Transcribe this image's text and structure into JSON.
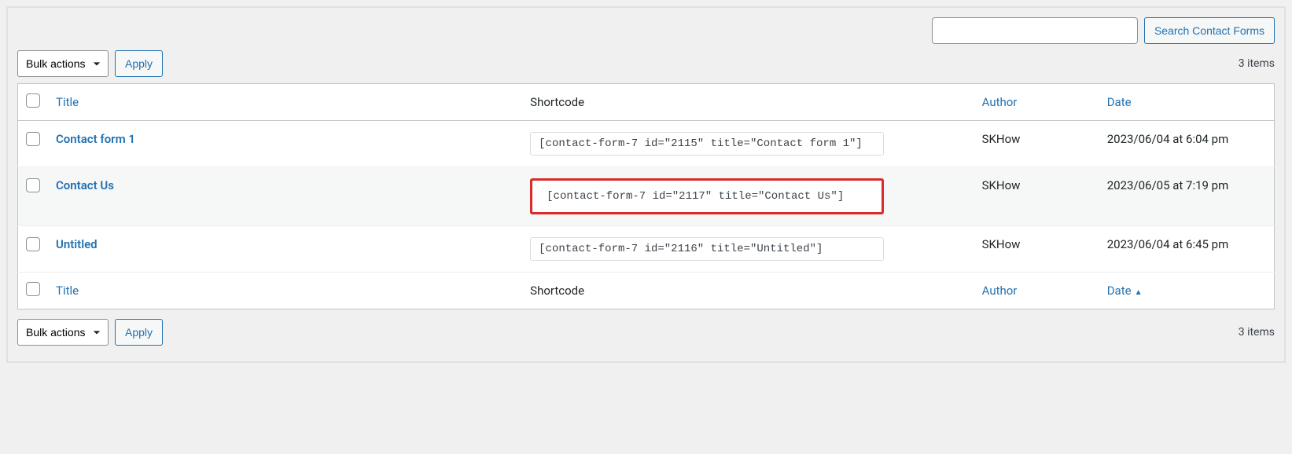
{
  "search": {
    "placeholder": "",
    "value": "",
    "button_label": "Search Contact Forms"
  },
  "tablenav_top": {
    "bulk_label": "Bulk actions",
    "apply_label": "Apply",
    "item_count": "3 items"
  },
  "tablenav_bottom": {
    "bulk_label": "Bulk actions",
    "apply_label": "Apply",
    "item_count": "3 items"
  },
  "columns": {
    "title": "Title",
    "shortcode": "Shortcode",
    "author": "Author",
    "date": "Date"
  },
  "rows": [
    {
      "title": "Contact form 1",
      "shortcode": "[contact-form-7 id=\"2115\" title=\"Contact form 1\"]",
      "author": "SKHow",
      "date": "2023/06/04 at 6:04 pm",
      "highlight": false
    },
    {
      "title": "Contact Us",
      "shortcode": "[contact-form-7 id=\"2117\" title=\"Contact Us\"]",
      "author": "SKHow",
      "date": "2023/06/05 at 7:19 pm",
      "highlight": true
    },
    {
      "title": "Untitled",
      "shortcode": "[contact-form-7 id=\"2116\" title=\"Untitled\"]",
      "author": "SKHow",
      "date": "2023/06/04 at 6:45 pm",
      "highlight": false
    }
  ],
  "sort_indicator": "▲"
}
